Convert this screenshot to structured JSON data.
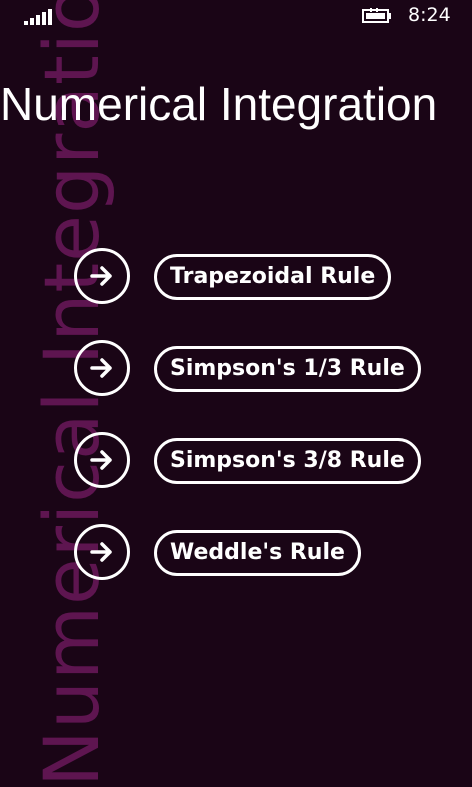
{
  "status_bar": {
    "signal_icon": "signal-strength-icon",
    "battery_icon": "battery-charging-icon",
    "time": "8:24"
  },
  "background": {
    "watermark_text": "Numerical Integration"
  },
  "header": {
    "title": "Numerical Integration"
  },
  "menu": {
    "arrow_icon": "arrow-right-icon",
    "items": [
      {
        "label": "Trapezoidal Rule"
      },
      {
        "label": "Simpson's 1/3 Rule"
      },
      {
        "label": "Simpson's 3/8 Rule"
      },
      {
        "label": "Weddle's Rule"
      }
    ]
  },
  "colors": {
    "background": "#1a0516",
    "watermark": "#5e1550",
    "foreground": "#ffffff"
  }
}
